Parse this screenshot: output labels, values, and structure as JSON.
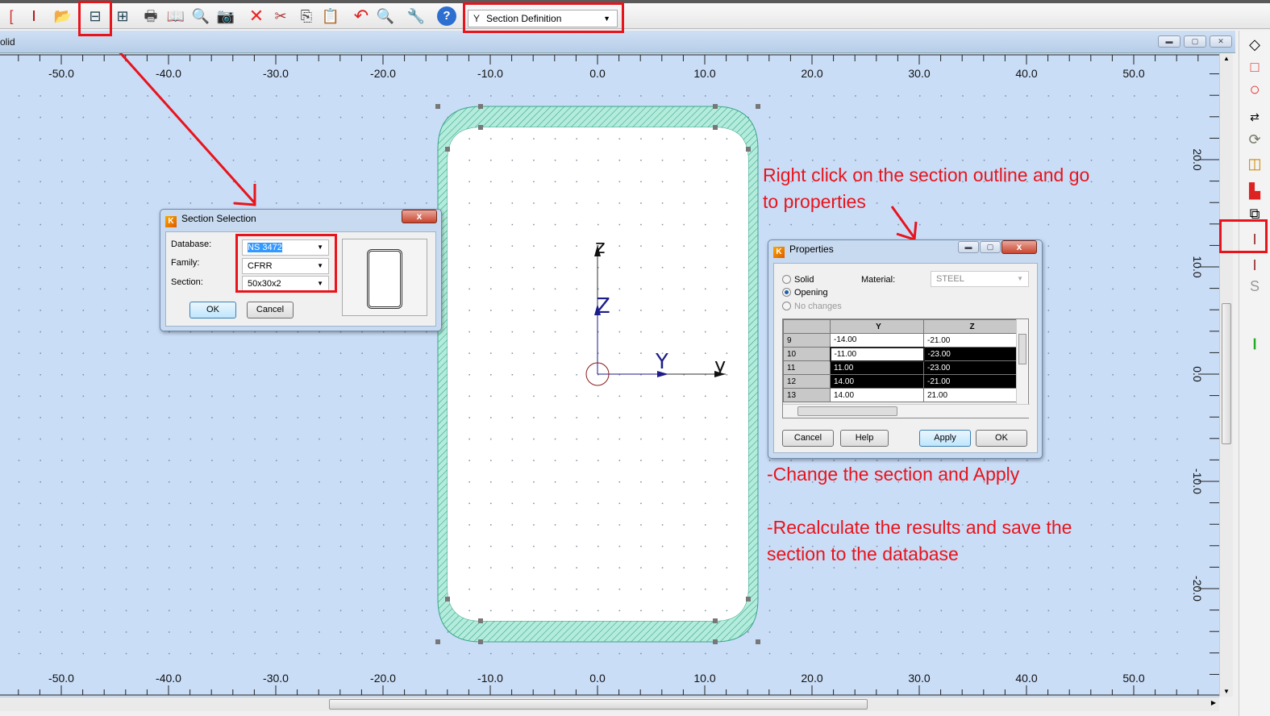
{
  "toolbar": {
    "icons": [
      "bracket-icon",
      "section-icon",
      "open-folder-icon",
      "section-database-icon",
      "section-export-icon",
      "print-icon",
      "book-icon",
      "print-preview-icon",
      "camera-icon",
      "delete-icon",
      "cut-icon",
      "copy-icon",
      "paste-icon",
      "undo-icon",
      "zoom-icon",
      "wrench-icon",
      "help-icon"
    ],
    "mode_select": {
      "value": "Section Definition"
    }
  },
  "window": {
    "title": "olid"
  },
  "rulers": {
    "x_labels": [
      "-50.0",
      "-40.0",
      "-30.0",
      "-20.0",
      "-10.0",
      "0.0",
      "10.0",
      "20.0",
      "30.0",
      "40.0",
      "50.0"
    ],
    "y_labels": [
      "20.0",
      "10.0",
      "0.0",
      "-10.0",
      "-20.0"
    ]
  },
  "drawing": {
    "axis_labels": {
      "z_local": "z",
      "z_principal": "Z",
      "y_principal": "Y",
      "y_local": "y"
    },
    "outline_fill": "#a8e6d6",
    "canvas_bg": "#c9ddf7"
  },
  "section_selection": {
    "title": "Section Selection",
    "database_label": "Database:",
    "database_value": "NS 3472",
    "family_label": "Family:",
    "family_value": "CFRR",
    "section_label": "Section:",
    "section_value": "50x30x2",
    "ok": "OK",
    "cancel": "Cancel"
  },
  "properties": {
    "title": "Properties",
    "radio_solid": "Solid",
    "radio_opening": "Opening",
    "radio_no_changes": "No changes",
    "selected_radio": "Opening",
    "material_label": "Material:",
    "material_value": "STEEL",
    "columns": [
      "Y",
      "Z"
    ],
    "rows": [
      {
        "n": "9",
        "y": "-14.00",
        "z": "-21.00"
      },
      {
        "n": "10",
        "y": "-11.00",
        "z": "-23.00"
      },
      {
        "n": "11",
        "y": "11.00",
        "z": "-23.00"
      },
      {
        "n": "12",
        "y": "14.00",
        "z": "-21.00"
      },
      {
        "n": "13",
        "y": "14.00",
        "z": "21.00"
      }
    ],
    "cancel": "Cancel",
    "help": "Help",
    "apply": "Apply",
    "ok": "OK"
  },
  "annotations": {
    "note1_line1": "Right click on the section outline and go",
    "note1_line2": "to properties",
    "note2": "-Change the section and Apply",
    "note3_line1": "-Recalculate the results and save the",
    "note3_line2": "section to the database",
    "highlight_color": "#e8141c"
  }
}
